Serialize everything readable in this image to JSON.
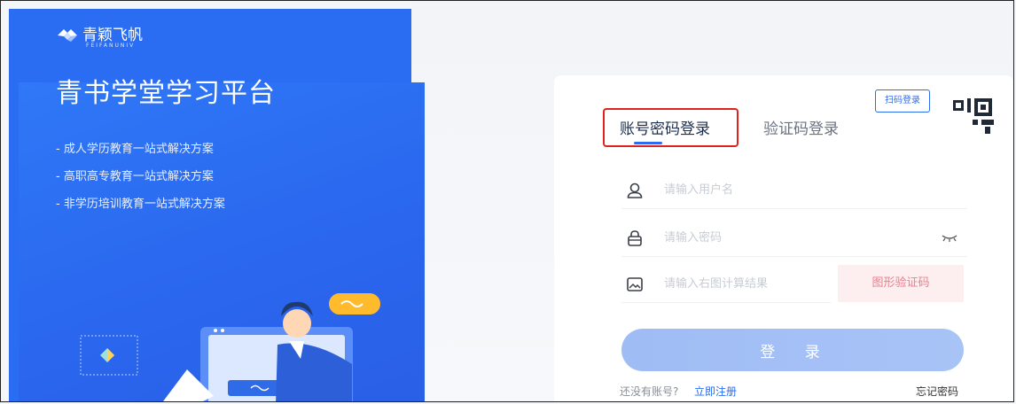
{
  "brand": {
    "name": "青颖飞帆",
    "sub": "FEIFANUNIV",
    "platform_title": "青书学堂学习平台",
    "features": [
      "- 成人学历教育一站式解决方案",
      "- 高职高专教育一站式解决方案",
      "- 非学历培训教育一站式解决方案"
    ]
  },
  "login": {
    "qr_tip": "扫码登录",
    "tabs": [
      "账号密码登录",
      "验证码登录"
    ],
    "username_placeholder": "请输入用户名",
    "password_placeholder": "请输入密码",
    "captcha_placeholder": "请输入右图计算结果",
    "captcha_label": "图形验证码",
    "submit_label": "登 录",
    "no_account_text": "还没有账号?",
    "register_label": "立即注册",
    "forgot_label": "忘记密码"
  },
  "colors": {
    "brand_blue": "#2b6df2",
    "accent_blue": "#2b6cf0",
    "highlight_red": "#e0221f",
    "button_blue_disabled": "#a3bff5"
  },
  "icons": [
    "brand-logo-icon",
    "user-icon",
    "lock-icon",
    "image-captcha-icon",
    "eye-closed-icon",
    "qr-code-icon"
  ]
}
